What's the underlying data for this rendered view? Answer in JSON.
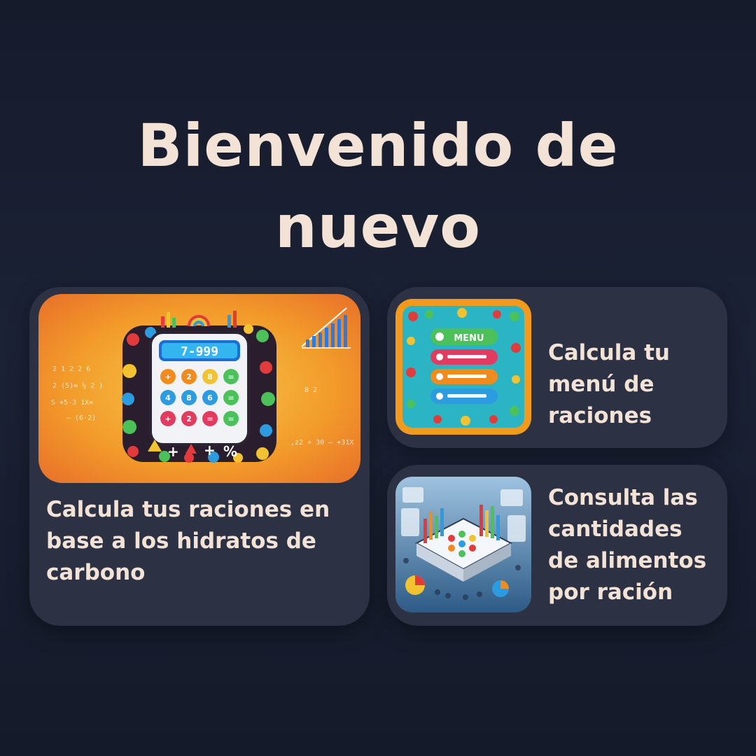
{
  "title": {
    "line1": "Bienvenido de",
    "line2": "nuevo"
  },
  "cards": [
    {
      "label": "Calcula tus raciones en base a los hidratos de carbono",
      "image_icon": "calculator-illustration",
      "display": "7-999"
    },
    {
      "label_lines": [
        "Calcula tu",
        "menú de",
        "raciones"
      ],
      "image_icon": "food-menu-illustration",
      "menu_word": "MENU"
    },
    {
      "label_lines": [
        "Consulta las",
        "cantidades",
        "de alimentos",
        "por ración"
      ],
      "image_icon": "data-charts-illustration"
    }
  ],
  "colors": {
    "background": "#1b2235",
    "card": "#2c3144",
    "text": "#f3e2d6"
  }
}
